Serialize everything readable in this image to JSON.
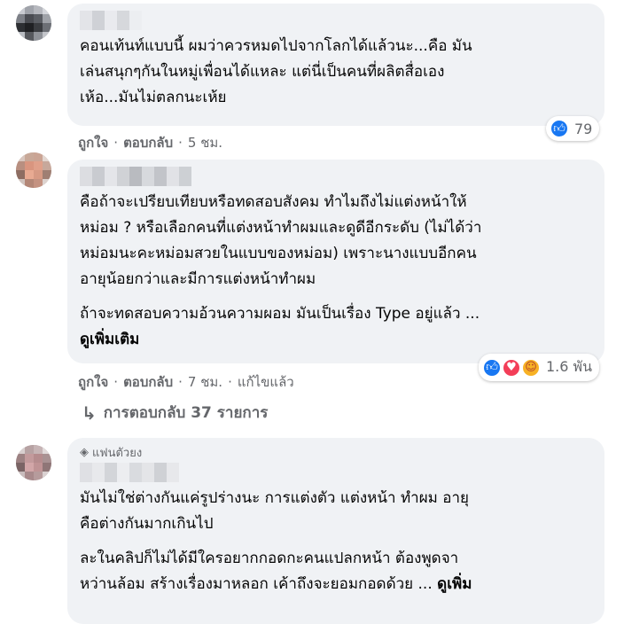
{
  "comments": [
    {
      "paragraphs": [
        "คอนเท้นท์แบบนี้ ผมว่าควรหมดไปจากโลกได้แล้วนะ...คือ มัน\nเล่นสนุกๆกันในหมู่เพื่อนได้แหละ แต่นี่เป็นคนที่ผลิตสื่อเอง\nเห้อ...มันไม่ตลกนะเห้ย"
      ],
      "actions": {
        "like": "ถูกใจ",
        "reply": "ตอบกลับ",
        "time": "5 ชม."
      },
      "reactions": {
        "count": "79",
        "icons": [
          "like-icon"
        ]
      }
    },
    {
      "paragraphs": [
        "คือถ้าจะเปรียบเทียบหรือทดสอบสังคม ทำไมถึงไม่แต่งหน้าให้\nหม่อม ? หรือเลือกคนที่แต่งหน้าทำผมและดูดีอีกระดับ (ไม่ได้ว่า\nหม่อมนะคะหม่อมสวยในแบบของหม่อม) เพราะนางแบบอีกคน\nอายุน้อยกว่าและมีการแต่งหน้าทำผม",
        "ถ้าจะทดสอบความอ้วนความผอม มันเป็นเรื่อง Type อยู่แล้ว ..."
      ],
      "see_more": "ดูเพิ่มเติม",
      "actions": {
        "like": "ถูกใจ",
        "reply": "ตอบกลับ",
        "time": "7 ชม.",
        "edited": "แก้ไขแล้ว"
      },
      "reactions": {
        "count": "1.6 พัน",
        "icons": [
          "like-icon",
          "love-icon",
          "care-icon"
        ]
      },
      "replies_label": "การตอบกลับ 37 รายการ"
    },
    {
      "badge": "แฟนตัวยง",
      "paragraphs": [
        "มันไม่ใช่ต่างกันแค่รูปร่างนะ การแต่งตัว แต่งหน้า ทำผม อายุ\nคือต่างกันมากเกินไป",
        "ละในคลิปก็ไม่ได้มีใครอยากกอดกะคนแปลกหน้า ต้องพูดจา\nหว่านล้อม สร้างเรื่องมาหลอก เค้าถึงจะยอมกอดด้วย ... "
      ],
      "see_more": "ดูเพิ่ม"
    }
  ],
  "colors": {
    "bubble": "#f0f2f5",
    "meta": "#65676b",
    "like": "#1877f2",
    "love": "#f33e58",
    "care": "#f7b125"
  }
}
